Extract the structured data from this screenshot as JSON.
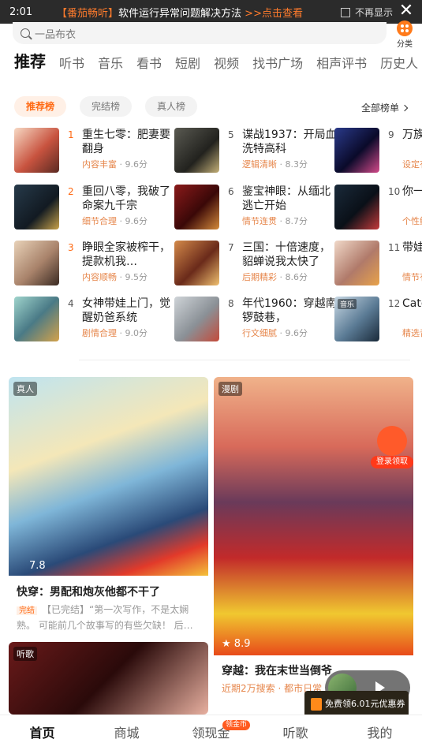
{
  "banner": {
    "time": "2:01",
    "tag": "【番茄畅听】",
    "message": "软件运行异常问题解决方法",
    "link": ">>点击查看",
    "dont_show": "不再显示",
    "close": "✕"
  },
  "search": {
    "placeholder": "一品布衣"
  },
  "category": {
    "label": "分类"
  },
  "tabs": [
    "推荐",
    "听书",
    "音乐",
    "看书",
    "短剧",
    "视频",
    "找书广场",
    "相声评书",
    "历史人"
  ],
  "chips": [
    "推荐榜",
    "完结榜",
    "真人榜"
  ],
  "all_rank": "全部榜单",
  "rank_items": [
    {
      "num": "1",
      "title": "重生七零：肥妻要翻身",
      "cat": "内容丰富",
      "score": "9.6分"
    },
    {
      "num": "2",
      "title": "重回八零，我破了命案九千宗",
      "cat": "细节合理",
      "score": "9.6分"
    },
    {
      "num": "3",
      "title": "睁眼全家被榨干，提款机我…",
      "cat": "内容顺畅",
      "score": "9.5分"
    },
    {
      "num": "4",
      "title": "女神带娃上门，觉醒奶爸系统",
      "cat": "剧情合理",
      "score": "9.0分"
    },
    {
      "num": "5",
      "title": "谍战1937：开局血洗特高科",
      "cat": "逻辑清晰",
      "score": "8.3分"
    },
    {
      "num": "6",
      "title": "鉴宝神眼：从缅北逃亡开始",
      "cat": "情节连贯",
      "score": "8.7分"
    },
    {
      "num": "7",
      "title": "三国：十倍速度，貂蝉说我太快了",
      "cat": "后期精彩",
      "score": "8.6分"
    },
    {
      "num": "8",
      "title": "年代1960：穿越南锣鼓巷，",
      "cat": "行文细腻",
      "score": "9.6分"
    },
    {
      "num": "9",
      "title": "万族局驯",
      "cat": "设定有",
      "score": ""
    },
    {
      "num": "10",
      "title": "你一刑侦",
      "cat": "个性鲜",
      "score": ""
    },
    {
      "num": "11",
      "title": "带娃女：",
      "cat": "情节有",
      "score": ""
    },
    {
      "num": "12",
      "title": "Catch（",
      "cat": "精选音",
      "score": "",
      "badge": "音乐"
    }
  ],
  "cards": {
    "c1": {
      "tag": "真人",
      "rating": "7.8",
      "title": "快穿：男配和炮灰他都不干了",
      "done": "完结",
      "desc": "【已完结】“第一次写作，不是太娴熟。 可能前几个故事写的有些欠缺！ 后…"
    },
    "c2": {
      "tag": "漫剧",
      "rating": "8.9",
      "title": "穿越：我在末世当倒爷",
      "desc": "近期2万搜索 · 都市日常"
    },
    "c3": {
      "tag": "听歌"
    }
  },
  "float": {
    "login": "登录领取",
    "coupon": "免费领6.01元优惠券"
  },
  "nav": [
    {
      "label": "首页"
    },
    {
      "label": "商城"
    },
    {
      "label": "领现金",
      "badge": "领金币"
    },
    {
      "label": "听歌"
    },
    {
      "label": "我的"
    }
  ]
}
